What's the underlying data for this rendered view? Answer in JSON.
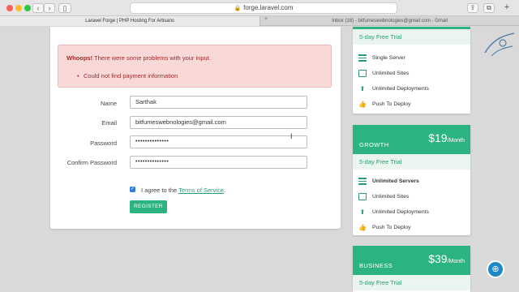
{
  "browser": {
    "url": "forge.laravel.com",
    "tabs": [
      {
        "label": "Laravel Forge | PHP Hosting For Artisans"
      },
      {
        "label": "Inbox (18) - bitfumeswebnologies@gmail.com - Gmail"
      }
    ]
  },
  "alert": {
    "title_strong": "Whoops!",
    "title_rest": " There were some problems with your input.",
    "errors": [
      "Could not find payment information"
    ]
  },
  "form": {
    "name_label": "Name",
    "name_value": "Sarthak",
    "email_label": "Email",
    "email_value": "bitfumeswebnologies@gmail.com",
    "password_label": "Password",
    "password_value": "••••••••••••••",
    "confirm_label": "Confirm Password",
    "confirm_value": "••••••••••••••",
    "agree_prefix": "I agree to the ",
    "agree_link": "Terms of Service",
    "agree_suffix": ".",
    "agree_checked": true,
    "register_label": "REGISTER"
  },
  "plans": [
    {
      "trial": "5-day Free Trial",
      "features": [
        {
          "label": "Single Server",
          "icon": "server-icon"
        },
        {
          "label": "Unlimited Sites",
          "icon": "site-icon"
        },
        {
          "label": "Unlimited Deployments",
          "icon": "upload-icon"
        },
        {
          "label": "Push To Deploy",
          "icon": "thumbs-up-icon"
        }
      ]
    },
    {
      "name": "GROWTH",
      "price": "$19",
      "period": "/Month",
      "trial": "5-day Free Trial",
      "features": [
        {
          "label": "Unlimited Servers",
          "icon": "server-icon",
          "bold": true
        },
        {
          "label": "Unlimited Sites",
          "icon": "site-icon"
        },
        {
          "label": "Unlimited Deployments",
          "icon": "upload-icon"
        },
        {
          "label": "Push To Deploy",
          "icon": "thumbs-up-icon"
        }
      ]
    },
    {
      "name": "BUSINESS",
      "price": "$39",
      "period": "/Month",
      "trial": "5-day Free Trial"
    }
  ],
  "colors": {
    "accent": "#2bb480",
    "alert_bg": "#f9d8d8",
    "alert_text": "#9e2a2a",
    "help_button": "#1e87c7"
  }
}
